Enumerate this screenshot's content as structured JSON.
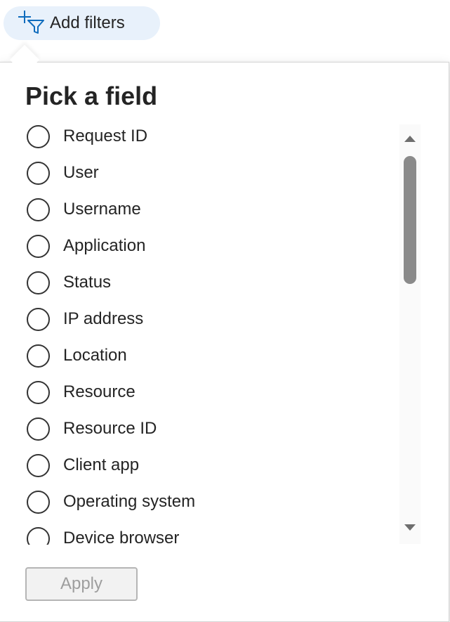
{
  "toolbar": {
    "add_filters_label": "Add filters",
    "add_filters_icon": "add-filter-icon",
    "pill_color": "#e8f1fb",
    "icon_color": "#0f6cbd"
  },
  "panel": {
    "title": "Pick a field",
    "fields": [
      {
        "label": "Request ID"
      },
      {
        "label": "User"
      },
      {
        "label": "Username"
      },
      {
        "label": "Application"
      },
      {
        "label": "Status"
      },
      {
        "label": "IP address"
      },
      {
        "label": "Location"
      },
      {
        "label": "Resource"
      },
      {
        "label": "Resource ID"
      },
      {
        "label": "Client app"
      },
      {
        "label": "Operating system"
      },
      {
        "label": "Device browser"
      }
    ],
    "apply_label": "Apply",
    "apply_disabled": true
  },
  "scrollbar": {
    "up_icon": "scroll-up-arrow-icon",
    "down_icon": "scroll-down-arrow-icon"
  }
}
